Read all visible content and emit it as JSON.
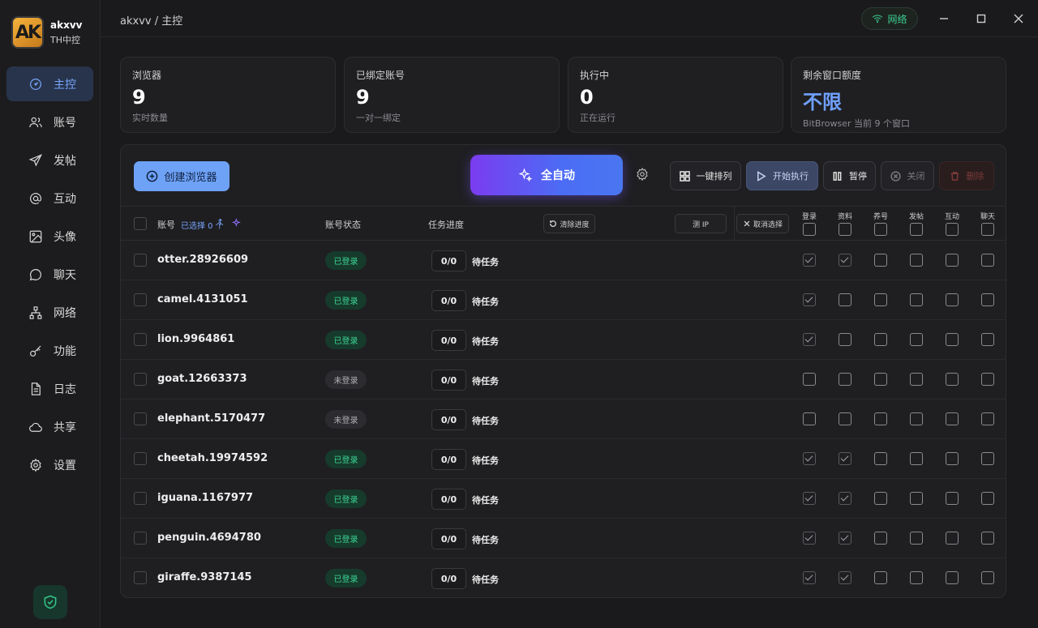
{
  "app": {
    "brand_initials": "AK",
    "brand_name": "akxvv",
    "brand_sub": "TH中控"
  },
  "sidebar": {
    "items": [
      {
        "label": "主控",
        "icon": "gauge-icon",
        "active": true
      },
      {
        "label": "账号",
        "icon": "users-icon"
      },
      {
        "label": "发帖",
        "icon": "send-icon"
      },
      {
        "label": "互动",
        "icon": "at-icon"
      },
      {
        "label": "头像",
        "icon": "image-icon"
      },
      {
        "label": "聊天",
        "icon": "chat-icon"
      },
      {
        "label": "网络",
        "icon": "network-icon"
      },
      {
        "label": "功能",
        "icon": "key-icon"
      },
      {
        "label": "日志",
        "icon": "document-icon"
      },
      {
        "label": "共享",
        "icon": "cloud-icon"
      },
      {
        "label": "设置",
        "icon": "gear-icon"
      }
    ],
    "bottom_icon": "shield-check-icon"
  },
  "topbar": {
    "breadcrumb": "akxvv / 主控",
    "network_label": "网络",
    "network_color": "#3ccf8e"
  },
  "stats": [
    {
      "label": "浏览器",
      "value": "9",
      "sub": "实时数量"
    },
    {
      "label": "已绑定账号",
      "value": "9",
      "sub": "一对一绑定"
    },
    {
      "label": "执行中",
      "value": "0",
      "sub": "正在运行"
    },
    {
      "label": "剩余窗口额度",
      "value": "不限",
      "sub": "BitBrowser 当前 9 个窗口"
    }
  ],
  "toolbar": {
    "create_label": "创建浏览器",
    "auto_label": "全自动",
    "arrange_label": "一键排列",
    "start_label": "开始执行",
    "pause_label": "暂停",
    "close_label": "关闭",
    "delete_label": "删除"
  },
  "table": {
    "col_account": "账号",
    "selected_text": "已选择 0 个",
    "col_status": "账号状态",
    "col_progress": "任务进度",
    "clear_progress": "清除进度",
    "test_ip": "测 IP",
    "cancel_select": "取消选择",
    "task_cols": [
      "登录",
      "资料",
      "养号",
      "发帖",
      "互动",
      "聊天"
    ],
    "rows": [
      {
        "name": "otter.28926609",
        "status": "已登录",
        "online": true,
        "progress": "0/0",
        "task": "待任务",
        "checks": [
          true,
          true,
          false,
          false,
          false,
          false
        ]
      },
      {
        "name": "camel.4131051",
        "status": "已登录",
        "online": true,
        "progress": "0/0",
        "task": "待任务",
        "checks": [
          true,
          false,
          false,
          false,
          false,
          false
        ]
      },
      {
        "name": "lion.9964861",
        "status": "已登录",
        "online": true,
        "progress": "0/0",
        "task": "待任务",
        "checks": [
          true,
          false,
          false,
          false,
          false,
          false
        ]
      },
      {
        "name": "goat.12663373",
        "status": "未登录",
        "online": false,
        "progress": "0/0",
        "task": "待任务",
        "checks": [
          false,
          false,
          false,
          false,
          false,
          false
        ]
      },
      {
        "name": "elephant.5170477",
        "status": "未登录",
        "online": false,
        "progress": "0/0",
        "task": "待任务",
        "checks": [
          false,
          false,
          false,
          false,
          false,
          false
        ]
      },
      {
        "name": "cheetah.19974592",
        "status": "已登录",
        "online": true,
        "progress": "0/0",
        "task": "待任务",
        "checks": [
          true,
          true,
          false,
          false,
          false,
          false
        ]
      },
      {
        "name": "iguana.1167977",
        "status": "已登录",
        "online": true,
        "progress": "0/0",
        "task": "待任务",
        "checks": [
          true,
          true,
          false,
          false,
          false,
          false
        ]
      },
      {
        "name": "penguin.4694780",
        "status": "已登录",
        "online": true,
        "progress": "0/0",
        "task": "待任务",
        "checks": [
          true,
          true,
          false,
          false,
          false,
          false
        ]
      },
      {
        "name": "giraffe.9387145",
        "status": "已登录",
        "online": true,
        "progress": "0/0",
        "task": "待任务",
        "checks": [
          true,
          true,
          false,
          false,
          false,
          false
        ]
      }
    ]
  }
}
